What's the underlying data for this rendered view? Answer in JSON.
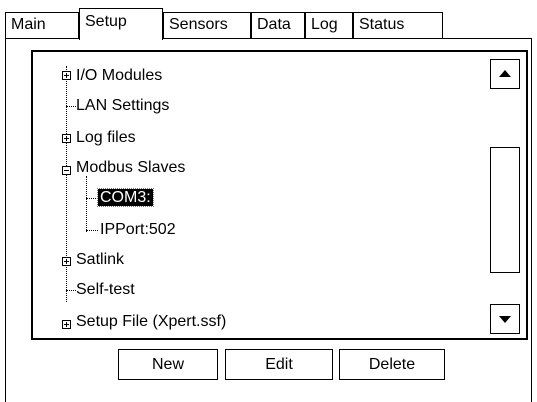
{
  "tabs": [
    {
      "label": "Main"
    },
    {
      "label": "Setup"
    },
    {
      "label": "Sensors"
    },
    {
      "label": "Data"
    },
    {
      "label": "Log"
    },
    {
      "label": "Status"
    }
  ],
  "active_tab": "Setup",
  "tree": {
    "items": [
      {
        "label": "I/O Modules",
        "expander": "+"
      },
      {
        "label": "LAN Settings",
        "expander": ""
      },
      {
        "label": "Log files",
        "expander": "+"
      },
      {
        "label": "Modbus Slaves",
        "expander": "-"
      },
      {
        "label": "COM3:",
        "expander": "",
        "selected": true
      },
      {
        "label": "IPPort:502",
        "expander": ""
      },
      {
        "label": "Satlink",
        "expander": "+"
      },
      {
        "label": "Self-test",
        "expander": ""
      },
      {
        "label": "Setup File (Xpert.ssf)",
        "expander": "+"
      }
    ]
  },
  "buttons": {
    "new_label": "New",
    "edit_label": "Edit",
    "delete_label": "Delete"
  }
}
